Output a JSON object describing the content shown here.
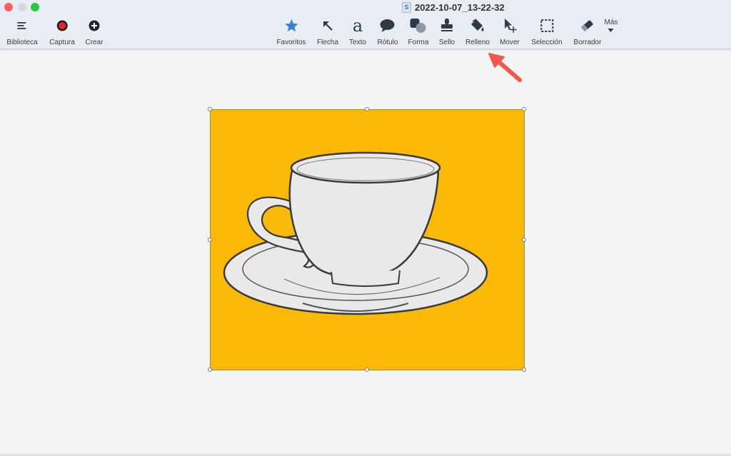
{
  "window": {
    "title": "2022-10-07_13-22-32",
    "doc_icon": "S"
  },
  "toolbar": {
    "left_tools": [
      {
        "label": "Biblioteca",
        "icon": "list-icon"
      },
      {
        "label": "Captura",
        "icon": "record-icon"
      },
      {
        "label": "Crear",
        "icon": "plus-circle-icon"
      }
    ],
    "tools": [
      {
        "label": "Favoritos",
        "icon": "star-icon"
      },
      {
        "label": "Flecha",
        "icon": "arrow-icon"
      },
      {
        "label": "Texto",
        "icon": "text-icon",
        "glyph": "a"
      },
      {
        "label": "Rótulo",
        "icon": "speech-bubble-icon"
      },
      {
        "label": "Forma",
        "icon": "shapes-icon"
      },
      {
        "label": "Sello",
        "icon": "stamp-icon"
      },
      {
        "label": "Relleno",
        "icon": "fill-bucket-icon"
      },
      {
        "label": "Mover",
        "icon": "move-cursor-icon"
      },
      {
        "label": "Selección",
        "icon": "selection-icon"
      },
      {
        "label": "Borrador",
        "icon": "eraser-icon"
      }
    ],
    "more_label": "Más"
  },
  "canvas": {
    "image_subject": "teacup-on-saucer",
    "background_color": "#fbb907"
  },
  "annotation": {
    "type": "arrow",
    "color": "#f2574c",
    "points_to": "Relleno"
  }
}
